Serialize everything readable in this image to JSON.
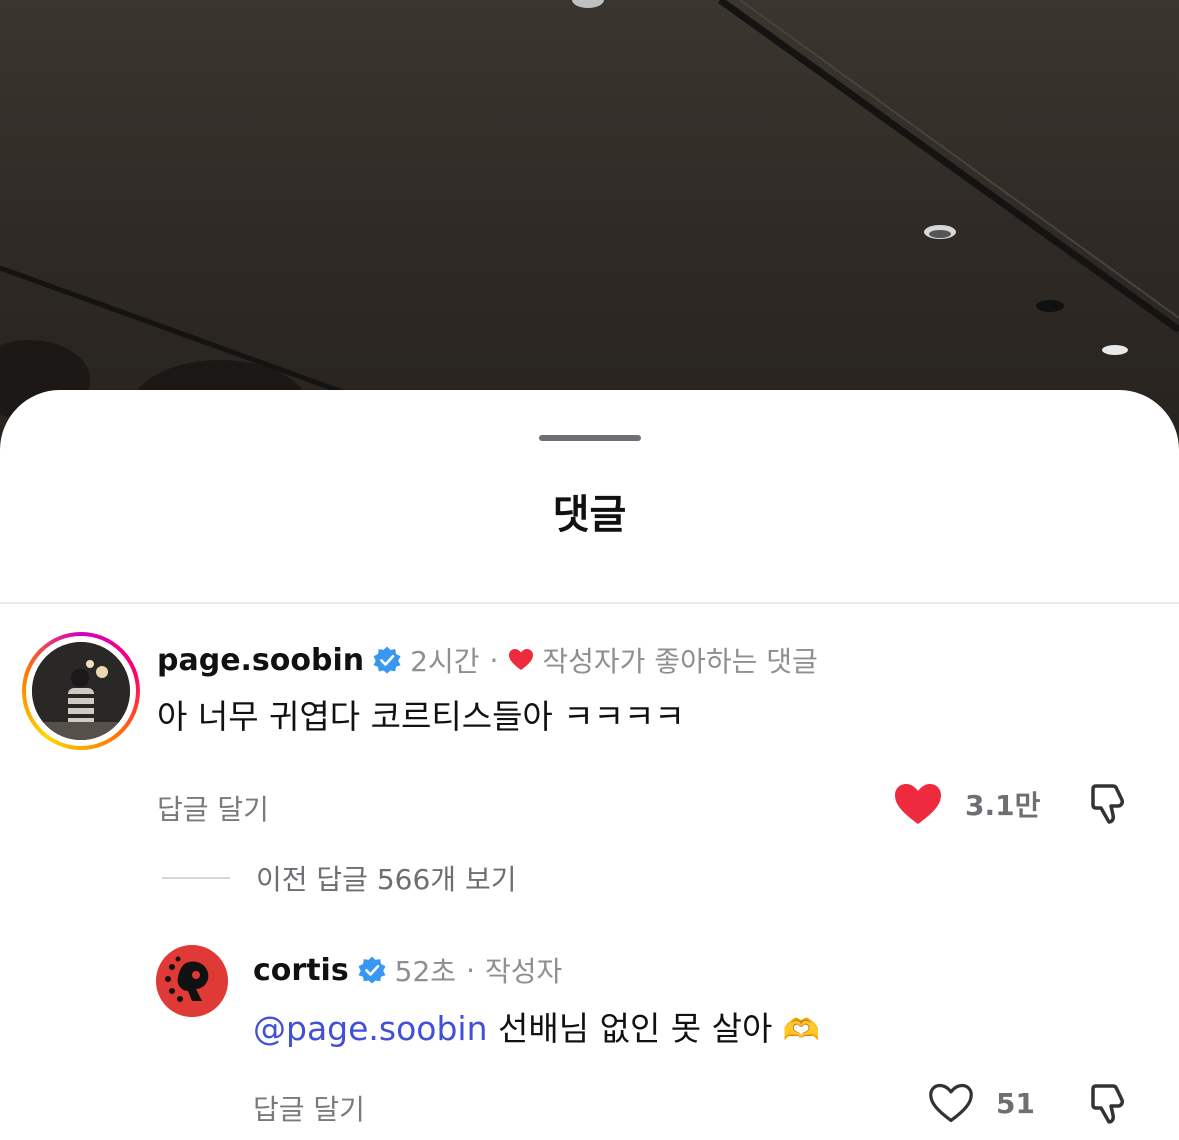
{
  "sheet": {
    "title": "댓글"
  },
  "comments": [
    {
      "username": "page.soobin",
      "verified": true,
      "time": "2시간",
      "separator": "·",
      "author_liked_label": "작성자가 좋아하는 댓글",
      "text": "아 너무 귀엽다 코르티스들아 ㅋㅋㅋㅋ",
      "reply_label": "답글 달기",
      "like_count": "3.1만",
      "liked": true,
      "view_prev_replies": "이전 답글 566개 보기"
    },
    {
      "username": "cortis",
      "verified": true,
      "time": "52초",
      "separator": "·",
      "author_tag": "작성자",
      "mention": "@page.soobin",
      "text": "선배님 없인 못 살아",
      "emoji": "🫶",
      "reply_label": "답글 달기",
      "like_count": "51",
      "liked": false
    }
  ],
  "colors": {
    "heart_red": "#ed2a3e",
    "verified_blue": "#3897f0",
    "mention_blue": "#4150d8",
    "cortis_avatar_red": "#e03a36"
  },
  "icons": {
    "verified": "verified-badge-icon",
    "heart_filled": "heart-filled-icon",
    "heart_outline": "heart-outline-icon",
    "dislike": "dislike-icon"
  }
}
